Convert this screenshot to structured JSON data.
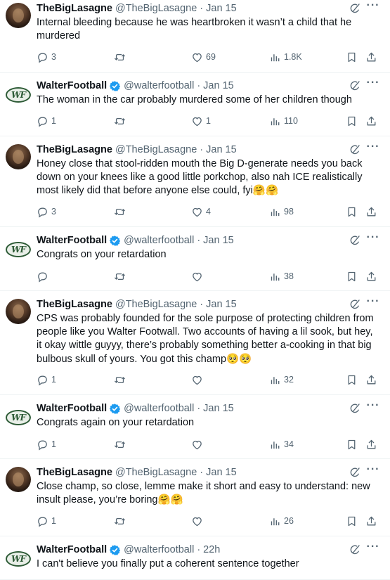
{
  "colors": {
    "text": "#0f1419",
    "muted": "#536471",
    "verified": "#1d9bf0",
    "border": "#eff3f4"
  },
  "tweets": [
    {
      "author": "lasagne",
      "name": "TheBigLasagne",
      "handle": "@TheBigLasagne",
      "date": "· Jan 15",
      "verified": false,
      "text": "Internal bleeding because he was heartbroken it wasn’t a child that he\nmurdered",
      "replies": "3",
      "retweets": "",
      "likes": "69",
      "views": "1.8K"
    },
    {
      "author": "wf",
      "name": "WalterFootball",
      "handle": "@walterfootball",
      "date": "· Jan 15",
      "verified": true,
      "text": "The woman in the car probably murdered some of her children though",
      "replies": "1",
      "retweets": "",
      "likes": "1",
      "views": "110"
    },
    {
      "author": "lasagne",
      "name": "TheBigLasagne",
      "handle": "@TheBigLasagne",
      "date": "· Jan 15",
      "verified": false,
      "text": "Honey close that stool-ridden mouth the Big D-generate needs you back\ndown on your knees like a good little porkchop, also nah ICE realistically\nmost likely did that before anyone else could, fyi🤗🤗",
      "replies": "3",
      "retweets": "",
      "likes": "4",
      "views": "98"
    },
    {
      "author": "wf",
      "name": "WalterFootball",
      "handle": "@walterfootball",
      "date": "· Jan 15",
      "verified": true,
      "text": "Congrats on your retardation",
      "replies": "",
      "retweets": "",
      "likes": "",
      "views": "38"
    },
    {
      "author": "lasagne",
      "name": "TheBigLasagne",
      "handle": "@TheBigLasagne",
      "date": "· Jan 15",
      "verified": false,
      "text": "CPS was probably founded for the sole purpose of protecting children from\npeople like you Walter Footwall. Two accounts of having a lil sook, but hey,\nit okay wittle guyyy, there’s probably something better a-cooking in that big\nbulbous skull of yours. You got this champ🥺🥺",
      "replies": "1",
      "retweets": "",
      "likes": "",
      "views": "32"
    },
    {
      "author": "wf",
      "name": "WalterFootball",
      "handle": "@walterfootball",
      "date": "· Jan 15",
      "verified": true,
      "text": "Congrats again on your retardation",
      "replies": "1",
      "retweets": "",
      "likes": "",
      "views": "34"
    },
    {
      "author": "lasagne",
      "name": "TheBigLasagne",
      "handle": "@TheBigLasagne",
      "date": "· Jan 15",
      "verified": false,
      "text": "Close champ, so close, lemme make it short and easy to understand: new\ninsult please, you’re boring🤗🤗",
      "replies": "1",
      "retweets": "",
      "likes": "",
      "views": "26"
    },
    {
      "author": "wf",
      "name": "WalterFootball",
      "handle": "@walterfootball",
      "date": "· 22h",
      "verified": true,
      "text": "I can't believe you finally put a coherent sentence together",
      "replies": "",
      "retweets": "",
      "likes": "",
      "views": ""
    }
  ],
  "icons": {
    "reply": "reply-icon",
    "retweet": "retweet-icon",
    "like": "heart-icon",
    "views": "views-icon",
    "bookmark": "bookmark-icon",
    "share": "share-icon",
    "grok": "grok-icon",
    "more": "more-icon",
    "verified": "verified-badge-icon"
  },
  "wf_logo_text": "WF"
}
